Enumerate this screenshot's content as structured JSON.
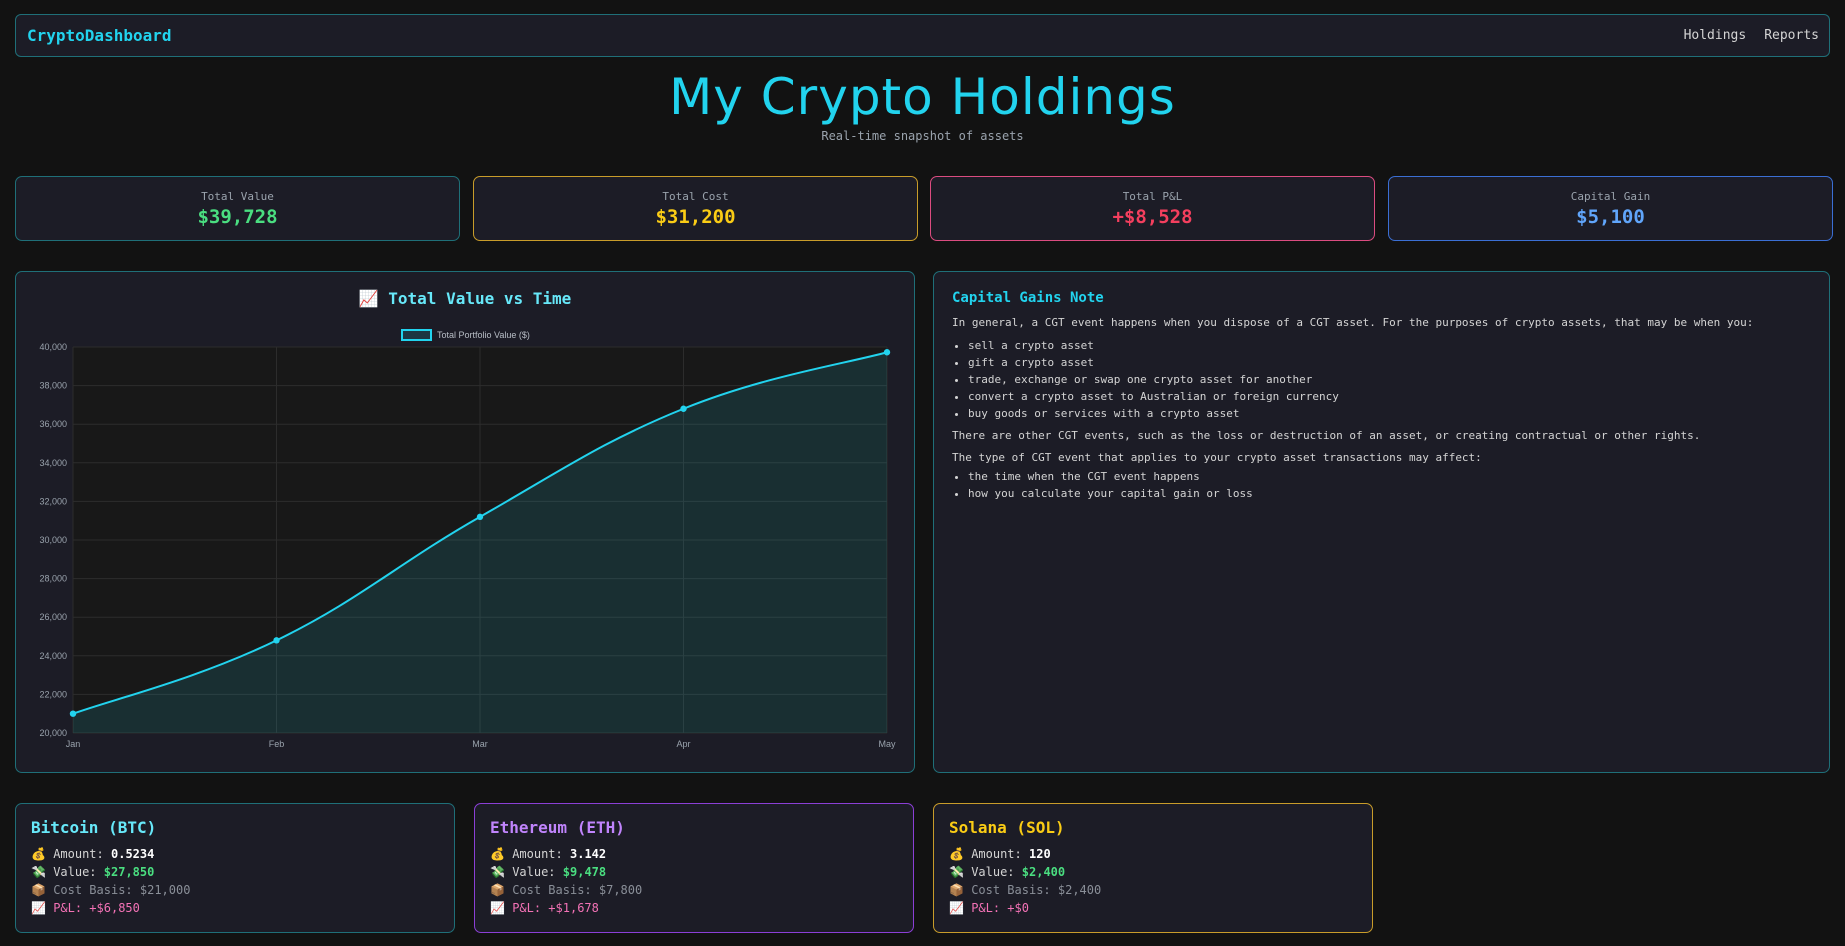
{
  "nav": {
    "brand": "CryptoDashboard",
    "links": [
      "Holdings",
      "Reports"
    ]
  },
  "hero": {
    "title": "My Crypto Holdings",
    "subtitle": "Real-time snapshot of assets"
  },
  "stats": [
    {
      "label": "Total Value",
      "value": "$39,728",
      "color": "#4ade80",
      "border": "#1f6f78"
    },
    {
      "label": "Total Cost",
      "value": "$31,200",
      "color": "#facc15",
      "border": "#c89c2a"
    },
    {
      "label": "Total P&L",
      "value": "+$8,528",
      "color": "#f43f5e",
      "border": "#db4c80"
    },
    {
      "label": "Capital Gain",
      "value": "$5,100",
      "color": "#60a5fa",
      "border": "#3b6fd4"
    }
  ],
  "chart_card": {
    "icon": "📈",
    "title": "Total Value vs Time"
  },
  "chart_data": {
    "type": "area",
    "title": "Total Value vs Time",
    "categories": [
      "Jan",
      "Feb",
      "Mar",
      "Apr",
      "May"
    ],
    "series": [
      {
        "name": "Total Portfolio Value ($)",
        "values": [
          21000,
          24800,
          31200,
          36800,
          39728
        ],
        "color": "#22d3ee"
      }
    ],
    "ylim": [
      20000,
      40000
    ],
    "yticks": [
      "20,000",
      "22,000",
      "24,000",
      "26,000",
      "28,000",
      "30,000",
      "32,000",
      "34,000",
      "36,000",
      "38,000",
      "40,000"
    ],
    "grid": true,
    "legend": "top-center"
  },
  "note": {
    "title": "Capital Gains Note",
    "intro": "In general, a CGT event happens when you dispose of a CGT asset. For the purposes of crypto assets, that may be when you:",
    "events": [
      "sell a crypto asset",
      "gift a crypto asset",
      "trade, exchange or swap one crypto asset for another",
      "convert a crypto asset to Australian or foreign currency",
      "buy goods or services with a crypto asset"
    ],
    "other": "There are other CGT events, such as the loss or destruction of an asset, or creating contractual or other rights.",
    "affect_intro": "The type of CGT event that applies to your crypto asset transactions may affect:",
    "affects": [
      "the time when the CGT event happens",
      "how you calculate your capital gain or loss"
    ]
  },
  "coins": [
    {
      "name": "Bitcoin (BTC)",
      "title_color": "#67e8f9",
      "border": "#1f6f78",
      "amount_icon": "💰",
      "amount_label": "Amount:",
      "amount": "0.5234",
      "value_icon": "💸",
      "value_label": "Value:",
      "value": "$27,850",
      "cost_icon": "📦",
      "cost": "Cost Basis: $21,000",
      "pnl_icon": "📈",
      "pnl": "P&L: +$6,850"
    },
    {
      "name": "Ethereum (ETH)",
      "title_color": "#c084fc",
      "border": "#8b3fd6",
      "amount_icon": "💰",
      "amount_label": "Amount:",
      "amount": "3.142",
      "value_icon": "💸",
      "value_label": "Value:",
      "value": "$9,478",
      "cost_icon": "📦",
      "cost": "Cost Basis: $7,800",
      "pnl_icon": "📈",
      "pnl": "P&L: +$1,678"
    },
    {
      "name": "Solana (SOL)",
      "title_color": "#facc15",
      "border": "#c89c2a",
      "amount_icon": "💰",
      "amount_label": "Amount:",
      "amount": "120",
      "value_icon": "💸",
      "value_label": "Value:",
      "value": "$2,400",
      "cost_icon": "📦",
      "cost": "Cost Basis: $2,400",
      "pnl_icon": "📈",
      "pnl": "P&L: +$0"
    }
  ]
}
